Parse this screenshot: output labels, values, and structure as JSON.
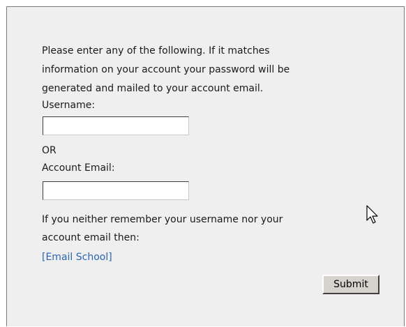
{
  "form": {
    "intro_line_1": "Please enter any of the following. If it matches",
    "intro_line_2": "information on your account your password will be",
    "intro_line_3": "generated and mailed to your account email.",
    "username_label": "Username:",
    "username_value": "",
    "or_label": "OR",
    "email_label": "Account Email:",
    "email_value": "",
    "help_line_1": "If you neither remember your username nor your",
    "help_line_2": "account email then:",
    "email_school_link": "[Email School]",
    "submit_label": "Submit"
  },
  "cursor": {
    "icon": "mouse-pointer-icon"
  },
  "colors": {
    "panel_background": "#efefef",
    "link": "#2a66b0",
    "button_face": "#d6d3ce"
  }
}
